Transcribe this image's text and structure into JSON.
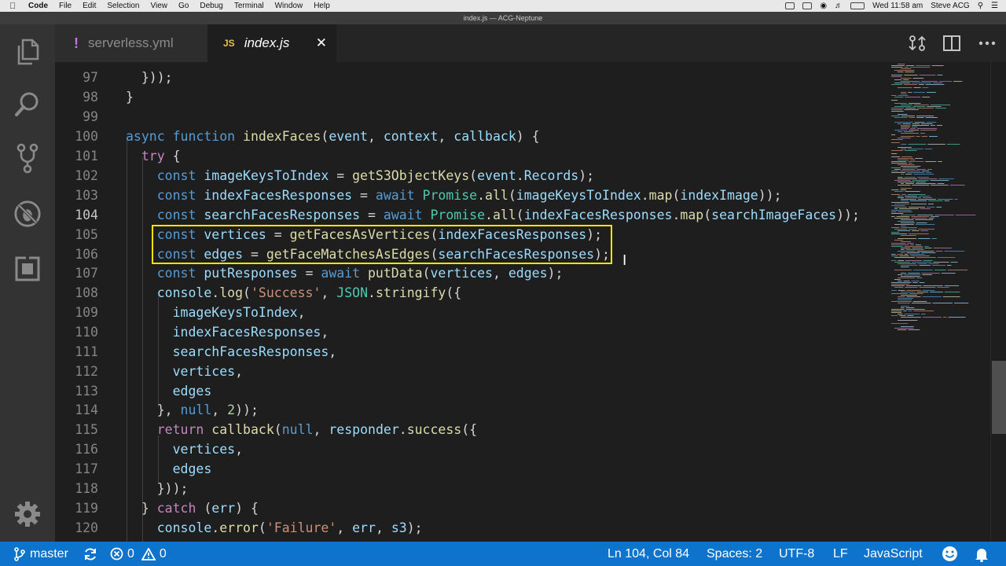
{
  "menubar": {
    "app": "Code",
    "items": [
      "File",
      "Edit",
      "Selection",
      "View",
      "Go",
      "Debug",
      "Terminal",
      "Window",
      "Help"
    ],
    "clock": "Wed 11:58 am",
    "user": "Steve ACG"
  },
  "window": {
    "title": "index.js — ACG-Neptune"
  },
  "activity_bar": {
    "icons": [
      "explorer-icon",
      "search-icon",
      "source-control-icon",
      "debug-icon",
      "extensions-icon",
      "gear-icon"
    ]
  },
  "tabs": [
    {
      "icon": "!",
      "label": "serverless.yml",
      "active": false
    },
    {
      "icon": "JS",
      "label": "index.js",
      "active": true,
      "close": "✕"
    }
  ],
  "editor": {
    "lines": [
      {
        "n": "97",
        "t": "  }));"
      },
      {
        "n": "98",
        "t": "}"
      },
      {
        "n": "99",
        "t": ""
      },
      {
        "n": "100",
        "t": "async function indexFaces(event, context, callback) {"
      },
      {
        "n": "101",
        "t": "  try {"
      },
      {
        "n": "102",
        "t": "    const imageKeysToIndex = getS3ObjectKeys(event.Records);"
      },
      {
        "n": "103",
        "t": "    const indexFacesResponses = await Promise.all(imageKeysToIndex.map(indexImage));"
      },
      {
        "n": "104",
        "t": "    const searchFacesResponses = await Promise.all(indexFacesResponses.map(searchImageFaces));"
      },
      {
        "n": "105",
        "t": "    const vertices = getFacesAsVertices(indexFacesResponses);"
      },
      {
        "n": "106",
        "t": "    const edges = getFaceMatchesAsEdges(searchFacesResponses);"
      },
      {
        "n": "107",
        "t": "    const putResponses = await putData(vertices, edges);"
      },
      {
        "n": "108",
        "t": "    console.log('Success', JSON.stringify({"
      },
      {
        "n": "109",
        "t": "      imageKeysToIndex,"
      },
      {
        "n": "110",
        "t": "      indexFacesResponses,"
      },
      {
        "n": "111",
        "t": "      searchFacesResponses,"
      },
      {
        "n": "112",
        "t": "      vertices,"
      },
      {
        "n": "113",
        "t": "      edges"
      },
      {
        "n": "114",
        "t": "    }, null, 2));"
      },
      {
        "n": "115",
        "t": "    return callback(null, responder.success({"
      },
      {
        "n": "116",
        "t": "      vertices,"
      },
      {
        "n": "117",
        "t": "      edges"
      },
      {
        "n": "118",
        "t": "    }));"
      },
      {
        "n": "119",
        "t": "  } catch (err) {"
      },
      {
        "n": "120",
        "t": "    console.error('Failure', err, s3);"
      }
    ],
    "active_line": "104"
  },
  "statusbar": {
    "branch": "master",
    "errors": "0",
    "warnings": "0",
    "position": "Ln 104, Col 84",
    "spaces": "Spaces: 2",
    "encoding": "UTF-8",
    "eol": "LF",
    "language": "JavaScript"
  },
  "colors": {
    "status_bar": "#0e73cc",
    "highlight_box": "#f2e600",
    "editor_bg": "#1e1e1e"
  }
}
